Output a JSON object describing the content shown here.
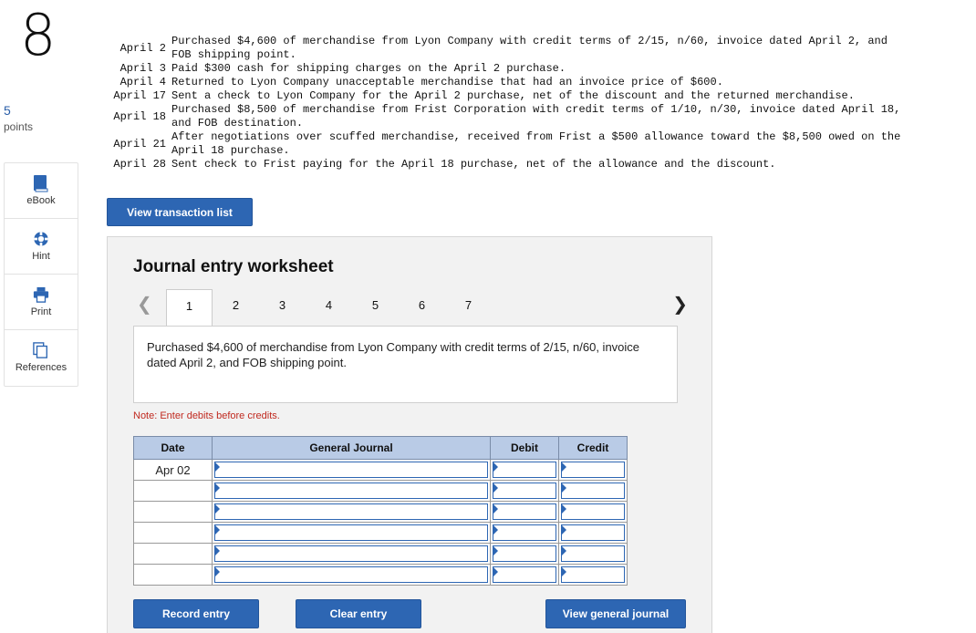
{
  "question": {
    "number": "8",
    "points_value": "5",
    "points_label": "points"
  },
  "tools": [
    {
      "label": "eBook",
      "icon": "book-icon"
    },
    {
      "label": "Hint",
      "icon": "hint-icon"
    },
    {
      "label": "Print",
      "icon": "print-icon"
    },
    {
      "label": "References",
      "icon": "references-icon"
    }
  ],
  "transactions": [
    {
      "date": "April 2",
      "lines": [
        "Purchased $4,600 of merchandise from Lyon Company with credit terms of 2/15, n/60, invoice dated April 2, and",
        "FOB shipping point."
      ]
    },
    {
      "date": "April 3",
      "lines": [
        "Paid $300 cash for shipping charges on the April 2 purchase."
      ]
    },
    {
      "date": "April 4",
      "lines": [
        "Returned to Lyon Company unacceptable merchandise that had an invoice price of $600."
      ]
    },
    {
      "date": "April 17",
      "lines": [
        "Sent a check to Lyon Company for the April 2 purchase, net of the discount and the returned merchandise."
      ]
    },
    {
      "date": "April 18",
      "lines": [
        "Purchased $8,500 of merchandise from Frist Corporation with credit terms of 1/10, n/30, invoice dated April 18,",
        "and FOB destination."
      ]
    },
    {
      "date": "April 21",
      "lines": [
        "After negotiations over scuffed merchandise, received from Frist a $500 allowance toward the $8,500 owed on the",
        "April 18 purchase."
      ]
    },
    {
      "date": "April 28",
      "lines": [
        "Sent check to Frist paying for the April 18 purchase, net of the allowance and the discount."
      ]
    }
  ],
  "buttons": {
    "view_transaction_list": "View transaction list",
    "record_entry": "Record entry",
    "clear_entry": "Clear entry",
    "view_general_journal": "View general journal"
  },
  "worksheet": {
    "title": "Journal entry worksheet",
    "pages": [
      "1",
      "2",
      "3",
      "4",
      "5",
      "6",
      "7"
    ],
    "active_page": "1",
    "description": "Purchased $4,600 of merchandise from Lyon Company with credit terms of 2/15, n/60, invoice dated April 2, and FOB shipping point.",
    "note": "Note: Enter debits before credits.",
    "table": {
      "headers": [
        "Date",
        "General Journal",
        "Debit",
        "Credit"
      ],
      "rows": [
        {
          "date": "Apr 02"
        },
        {
          "date": ""
        },
        {
          "date": ""
        },
        {
          "date": ""
        },
        {
          "date": ""
        },
        {
          "date": ""
        }
      ]
    }
  }
}
